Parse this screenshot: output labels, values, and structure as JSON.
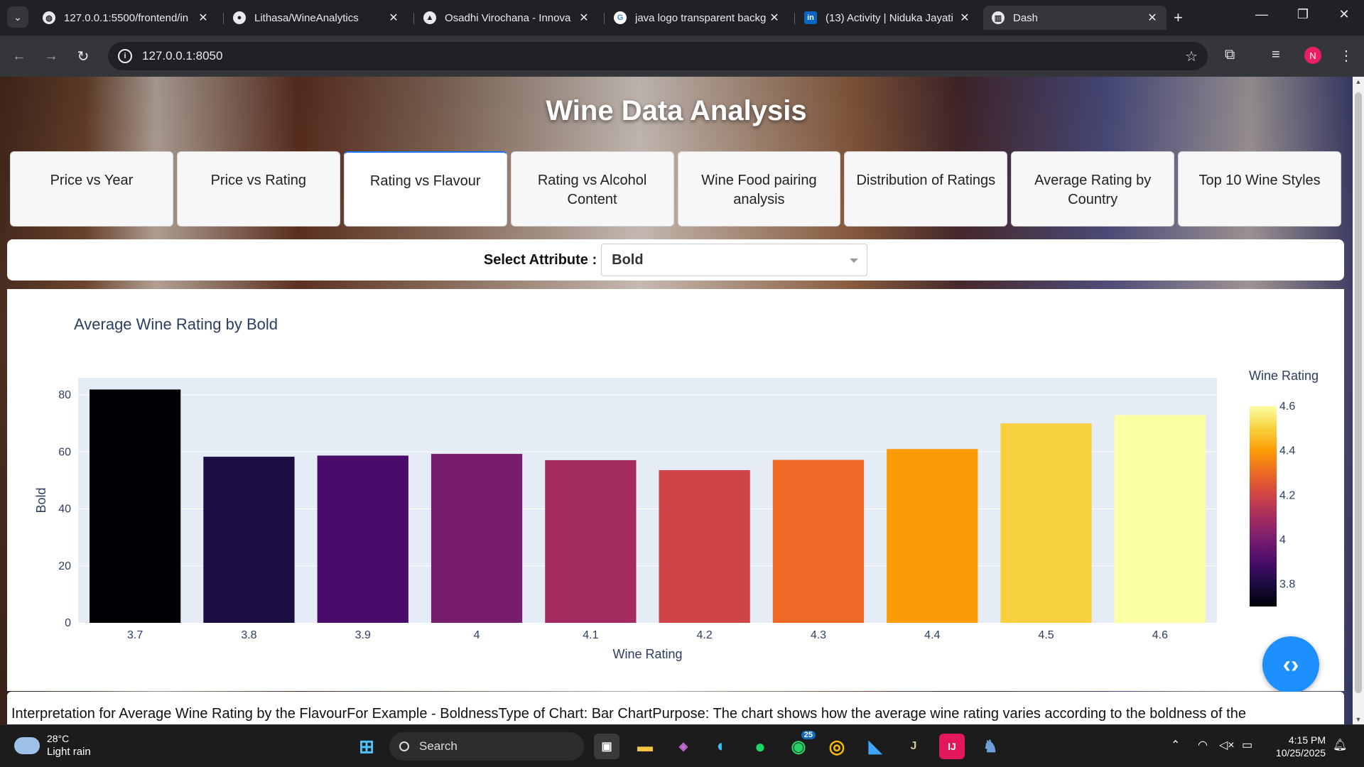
{
  "browser": {
    "tabs": [
      {
        "title": "127.0.0.1:5500/frontend/in",
        "favicon": "globe-icon",
        "active": false
      },
      {
        "title": "Lithasa/WineAnalytics",
        "favicon": "github-icon",
        "active": false
      },
      {
        "title": "Osadhi Virochana - Innova",
        "favicon": "triangle-icon",
        "active": false
      },
      {
        "title": "java logo transparent backg",
        "favicon": "google-icon",
        "active": false
      },
      {
        "title": "(13) Activity | Niduka Jayati",
        "favicon": "linkedin-icon",
        "active": false
      },
      {
        "title": "Dash",
        "favicon": "dash-icon",
        "active": true
      }
    ],
    "url": "127.0.0.1:8050",
    "profile_initial": "N"
  },
  "page": {
    "title": "Wine Data Analysis",
    "tabs": [
      "Price vs Year",
      "Price vs Rating",
      "Rating vs Flavour",
      "Rating vs Alcohol Content",
      "Wine Food pairing analysis",
      "Distribution of Ratings",
      "Average Rating by Country",
      "Top 10 Wine Styles"
    ],
    "active_tab_index": 2,
    "select_label": "Select Attribute :",
    "selected_attribute": "Bold",
    "interpretation": "Interpretation for Average Wine Rating by the FlavourFor Example - BoldnessType of Chart: Bar ChartPurpose: The chart shows how the average wine rating varies according to the boldness of the"
  },
  "chart_data": {
    "type": "bar",
    "title": "Average Wine Rating by Bold",
    "xlabel": "Wine Rating",
    "ylabel": "Bold",
    "categories": [
      "3.7",
      "3.8",
      "3.9",
      "4",
      "4.1",
      "4.2",
      "4.3",
      "4.4",
      "4.5",
      "4.6"
    ],
    "values": [
      81.9,
      58.3,
      58.7,
      59.3,
      57.1,
      53.6,
      57.2,
      61.0,
      70.0,
      72.9
    ],
    "ylim": [
      0,
      86
    ],
    "yticks": [
      0,
      20,
      40,
      60,
      80
    ],
    "colorbar": {
      "title": "Wine Rating",
      "ticks": [
        "4.6",
        "4.4",
        "4.2",
        "4",
        "3.8"
      ],
      "range": [
        3.7,
        4.6
      ]
    },
    "bar_colors": [
      "#000004",
      "#1b0c41",
      "#4a0c6b",
      "#781c6d",
      "#a52c60",
      "#cf4446",
      "#ed6925",
      "#fb9b06",
      "#f7d13d",
      "#fcffa4"
    ],
    "plot_background": "#e5ecf6",
    "grid": true
  },
  "taskbar": {
    "weather_temp": "28°C",
    "weather_condition": "Light rain",
    "search_label": "Search",
    "time": "4:15 PM",
    "date": "10/25/2025",
    "whatsapp_badge": "25"
  }
}
